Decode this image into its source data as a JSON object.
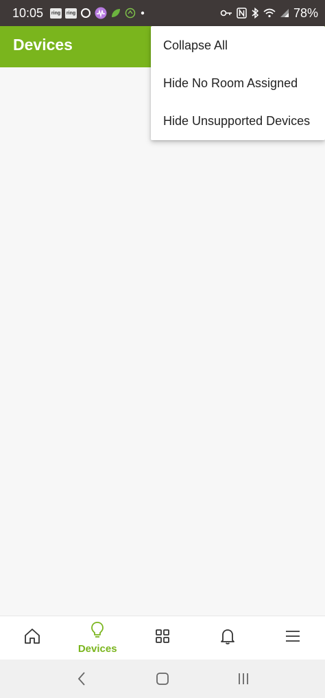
{
  "status_bar": {
    "time": "10:05",
    "notification_icons": [
      "ring",
      "ring"
    ],
    "battery_percent": "78%"
  },
  "app_bar": {
    "title": "Devices",
    "color": "#7ab51d"
  },
  "overflow_menu": {
    "items": [
      {
        "label": "Collapse All"
      },
      {
        "label": "Hide No Room Assigned"
      },
      {
        "label": "Hide Unsupported Devices"
      }
    ]
  },
  "bottom_nav": {
    "active_label": "Devices",
    "active_color": "#7ab51d",
    "items": [
      "home-icon",
      "lightbulb-icon",
      "grid-icon",
      "bell-icon",
      "menu-icon"
    ]
  },
  "system_nav": {
    "buttons": [
      "back",
      "home",
      "recents"
    ]
  }
}
